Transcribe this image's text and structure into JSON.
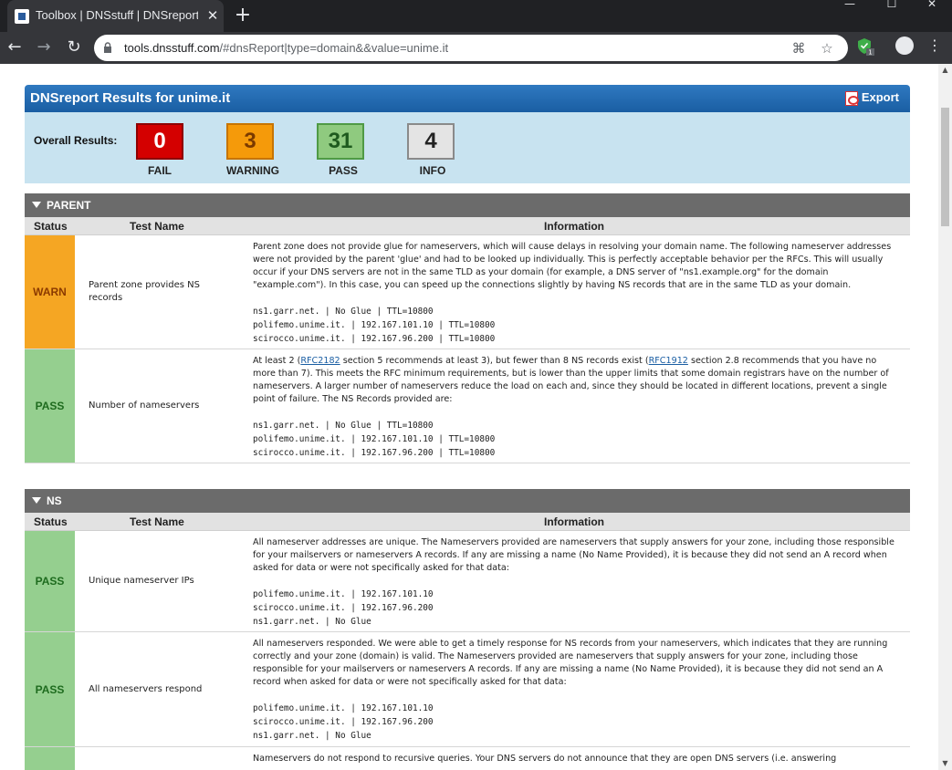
{
  "browser": {
    "tab_title": "Toolbox | DNSstuff | DNSreport R",
    "url_host": "tools.dnsstuff.com",
    "url_path": "/#dnsReport|type=domain&&value=unime.it",
    "extension_badge": "1"
  },
  "report": {
    "title": "DNSreport Results for unime.it",
    "export_label": "Export",
    "overall_label": "Overall Results:",
    "scores": [
      {
        "value": "0",
        "label": "FAIL",
        "bg": "#d40000",
        "border": "#8e0000",
        "color": "#ffffff"
      },
      {
        "value": "3",
        "label": "WARNING",
        "bg": "#f59a0a",
        "border": "#c77400",
        "color": "#7a3a00"
      },
      {
        "value": "31",
        "label": "PASS",
        "bg": "#8fca7f",
        "border": "#4f9a45",
        "color": "#1e5a1e"
      },
      {
        "value": "4",
        "label": "INFO",
        "bg": "#e4e4e4",
        "border": "#8a8a8a",
        "color": "#222222"
      }
    ]
  },
  "columns": {
    "status": "Status",
    "test": "Test Name",
    "info": "Information"
  },
  "parent": {
    "title": "PARENT",
    "rows": [
      {
        "status": "WARN",
        "name": "Parent zone provides NS records",
        "text": "Parent zone does not provide glue for nameservers, which will cause delays in resolving your domain name. The following nameserver addresses were not provided by the parent 'glue' and had to be looked up individually. This is perfectly acceptable behavior per the RFCs. This will usually occur if your DNS servers are not in the same TLD as your domain (for example, a DNS server of \"ns1.example.org\" for the domain \"example.com\"). In this case, you can speed up the connections slightly by having NS records that are in the same TLD as your domain.",
        "records": [
          "ns1.garr.net. | No Glue | TTL=10800",
          "polifemo.unime.it. | 192.167.101.10 | TTL=10800",
          "scirocco.unime.it. | 192.167.96.200 | TTL=10800"
        ]
      },
      {
        "status": "PASS",
        "name": "Number of nameservers",
        "text_a": "At least 2 (",
        "link_a": "RFC2182",
        "text_b": " section 5 recommends at least 3), but fewer than 8 NS records exist (",
        "link_b": "RFC1912",
        "text_c": " section 2.8 recommends that you have no more than 7). This meets the RFC minimum requirements, but is lower than the upper limits that some domain registrars have on the number of nameservers. A larger number of nameservers reduce the load on each and, since they should be located in different locations, prevent a single point of failure. The NS Records provided are:",
        "records": [
          "ns1.garr.net. | No Glue | TTL=10800",
          "polifemo.unime.it. | 192.167.101.10 | TTL=10800",
          "scirocco.unime.it. | 192.167.96.200 | TTL=10800"
        ]
      }
    ]
  },
  "ns": {
    "title": "NS",
    "rows": [
      {
        "status": "PASS",
        "name": "Unique nameserver IPs",
        "text": "All nameserver addresses are unique. The Nameservers provided are nameservers that supply answers for your zone, including those responsible for your mailservers or nameservers A records. If any are missing a name (No Name Provided), it is because they did not send an A record when asked for data or were not specifically asked for that data:",
        "records": [
          "polifemo.unime.it. | 192.167.101.10",
          "scirocco.unime.it. | 192.167.96.200",
          "ns1.garr.net. | No Glue"
        ]
      },
      {
        "status": "PASS",
        "name": "All nameservers respond",
        "text": "All nameservers responded. We were able to get a timely response for NS records from your nameservers, which indicates that they are running correctly and your zone (domain) is valid. The Nameservers provided are nameservers that supply answers for your zone, including those responsible for your mailservers or nameservers A records. If any are missing a name (No Name Provided), it is because they did not send an A record when asked for data or were not specifically asked for that data:",
        "records": [
          "polifemo.unime.it. | 192.167.101.10",
          "scirocco.unime.it. | 192.167.96.200",
          "ns1.garr.net. | No Glue"
        ]
      },
      {
        "status": "PASS",
        "name": "",
        "text": "Nameservers do not respond to recursive queries. Your DNS servers do not announce that they are open DNS servers (i.e. answering"
      }
    ]
  }
}
